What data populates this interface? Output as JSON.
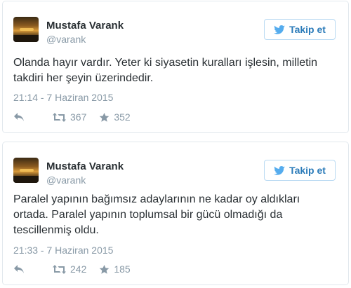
{
  "tweets": [
    {
      "name": "Mustafa Varank",
      "handle": "@varank",
      "follow_label": "Takip et",
      "text": "Olanda hayır vardır. Yeter ki siyasetin kuralları işlesin, milletin takdiri her şeyin üzerindedir.",
      "date": "21:14 - 7 Haziran 2015",
      "retweets": "367",
      "favorites": "352"
    },
    {
      "name": "Mustafa Varank",
      "handle": "@varank",
      "follow_label": "Takip et",
      "text": "Paralel yapının bağımsız adaylarının ne kadar oy aldıkları ortada. Paralel yapının toplumsal bir gücü olmadığı da tescillenmiş oldu.",
      "date": "21:33 - 7 Haziran 2015",
      "retweets": "242",
      "favorites": "185"
    }
  ],
  "colors": {
    "accent": "#2b7bb9",
    "muted": "#8899a6",
    "border": "#e1e8ed",
    "text": "#292f33"
  },
  "icons": [
    "twitter-bird-icon",
    "reply-icon",
    "retweet-icon",
    "star-icon"
  ]
}
